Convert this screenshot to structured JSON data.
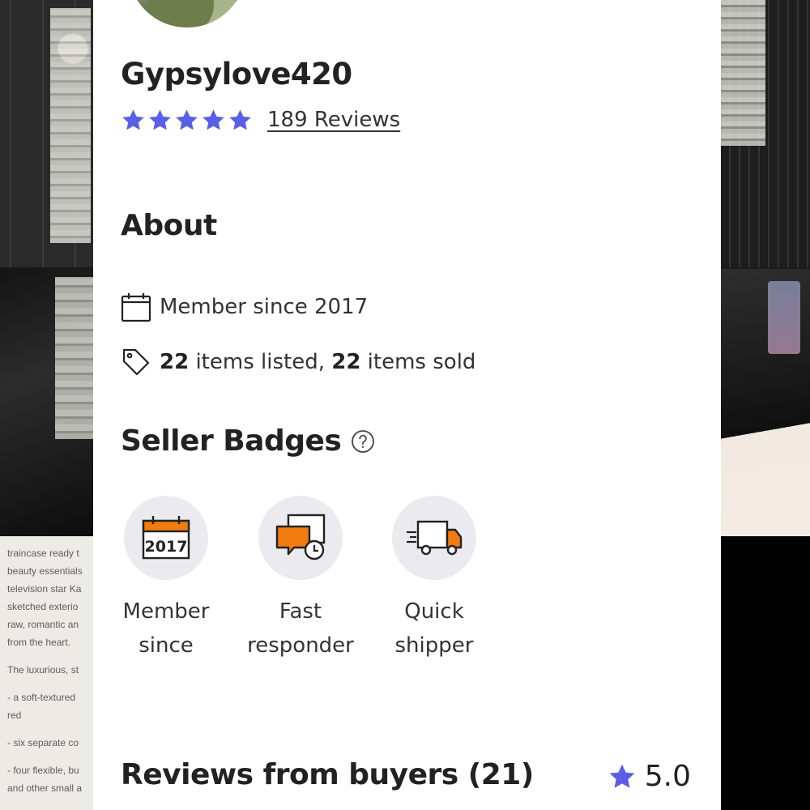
{
  "background": {
    "description_lines": [
      "traincase ready t",
      "beauty essentials",
      "television star Ka",
      "sketched exterio",
      "raw, romantic an",
      "from the heart.",
      "The luxurious, st",
      "- a soft-textured",
      "red",
      "- six separate co",
      "- four flexible, bu",
      "and other small a"
    ]
  },
  "profile": {
    "username": "Gypsylove420",
    "rating_stars": 5,
    "reviews_link": "189 Reviews"
  },
  "about": {
    "title": "About",
    "member_since": "Member since 2017",
    "items_listed_count": "22",
    "items_listed_text": " items listed, ",
    "items_sold_count": "22",
    "items_sold_text": " items sold"
  },
  "badges": {
    "title": "Seller Badges",
    "items": [
      {
        "icon": "calendar-2017-icon",
        "year": "2017",
        "line1": "Member",
        "line2": "since"
      },
      {
        "icon": "chat-clock-icon",
        "line1": "Fast",
        "line2": "responder"
      },
      {
        "icon": "delivery-truck-icon",
        "line1": "Quick",
        "line2": "shipper"
      }
    ]
  },
  "buyer_reviews": {
    "title": "Reviews from buyers (21)",
    "rating": "5.0"
  },
  "colors": {
    "accent_star": "#5b5ee6",
    "badge_orange": "#f07b10",
    "badge_bg": "#ebebef"
  }
}
